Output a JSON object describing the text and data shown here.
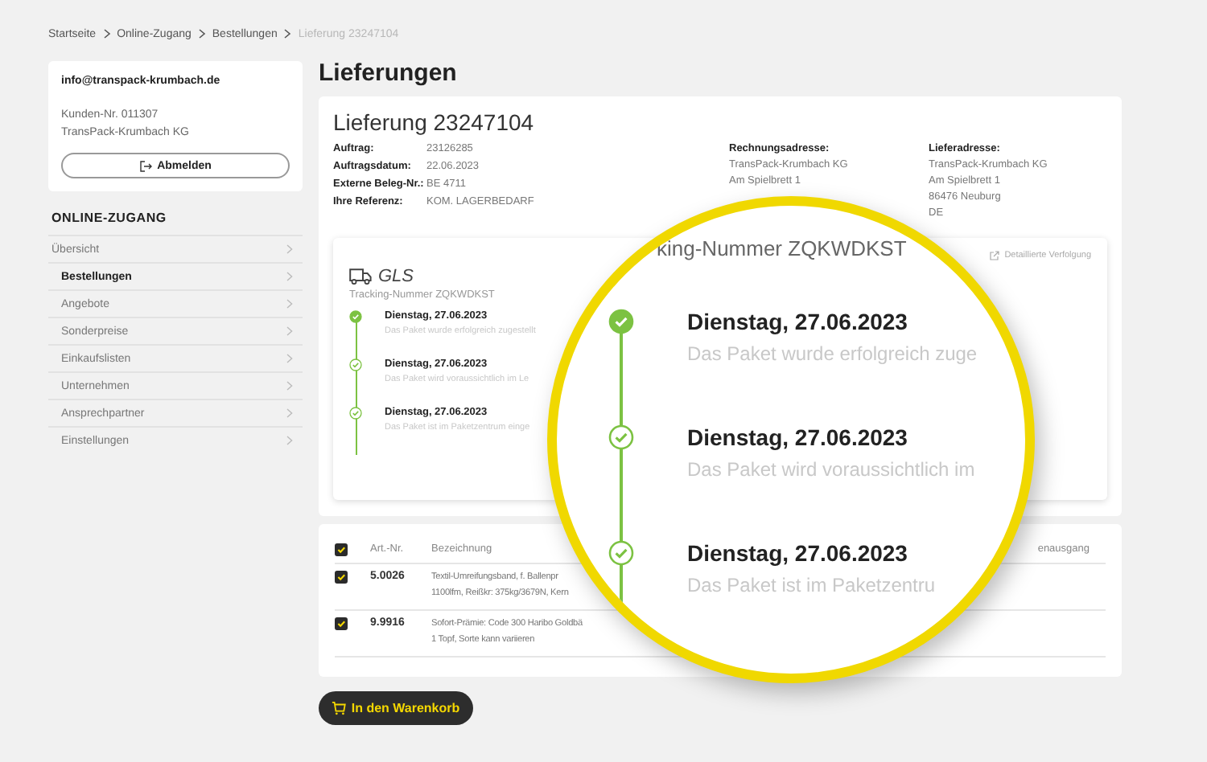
{
  "breadcrumb": [
    {
      "label": "Startseite",
      "current": false
    },
    {
      "label": "Online-Zugang",
      "current": false
    },
    {
      "label": "Bestellungen",
      "current": false
    },
    {
      "label": "Lieferung 23247104",
      "current": true
    }
  ],
  "account": {
    "email": "info@transpack-krumbach.de",
    "customer_no": "Kunden-Nr. 011307",
    "company": "TransPack-Krumbach KG",
    "logout_button": "Abmelden"
  },
  "nav": {
    "title": "ONLINE-ZUGANG",
    "items": [
      {
        "label": "Übersicht",
        "selected": false,
        "children": [
          {
            "label": "Bestellungen",
            "selected": true
          },
          {
            "label": "Angebote",
            "selected": false
          },
          {
            "label": "Sonderpreise",
            "selected": false
          },
          {
            "label": "Einkaufslisten",
            "selected": false
          },
          {
            "label": "Unternehmen",
            "selected": false
          },
          {
            "label": "Ansprechpartner",
            "selected": false
          },
          {
            "label": "Einstellungen",
            "selected": false
          }
        ]
      }
    ]
  },
  "page_title": "Lieferungen",
  "delivery": {
    "title": "Lieferung 23247104",
    "details": [
      {
        "label": "Auftrag:",
        "value": "23126285"
      },
      {
        "label": "Auftragsdatum:",
        "value": "22.06.2023"
      },
      {
        "label": "Externe Beleg-Nr.:",
        "value": "BE 4711"
      },
      {
        "label": "Ihre Referenz:",
        "value": "KOM. LAGERBEDARF"
      }
    ],
    "billing_address": {
      "title": "Rechnungsadresse:",
      "lines": [
        "TransPack-Krumbach KG",
        "Am Spielbrett 1"
      ]
    },
    "shipping_address": {
      "title": "Lieferadresse:",
      "lines": [
        "TransPack-Krumbach KG",
        "Am Spielbrett 1",
        "86476 Neuburg",
        "DE"
      ]
    }
  },
  "tracking": {
    "detail_link": "Detaillierte Verfolgung",
    "carrier": "GLS",
    "tracking_number": "Tracking-Nummer ZQKWDKST",
    "events": [
      {
        "date": "Dienstag, 27.06.2023",
        "text": "Das Paket wurde erfolgreich zugestellt",
        "done": true
      },
      {
        "date": "Dienstag, 27.06.2023",
        "text": "Das Paket wird voraussichtlich im Le",
        "done": false
      },
      {
        "date": "Dienstag, 27.06.2023",
        "text": "Das Paket ist im Paketzentrum einge",
        "done": false
      }
    ]
  },
  "items_table": {
    "header_checked": true,
    "columns": [
      "Art.-Nr.",
      "Bezeichnung",
      "enausgang"
    ],
    "rows": [
      {
        "checked": true,
        "number": "5.0026",
        "description": [
          "Textil-Umreifungsband, f. Ballenpr",
          "1100lfm, Reißkr: 375kg/3679N, Kern"
        ]
      },
      {
        "checked": true,
        "number": "9.9916",
        "description": [
          "Sofort-Prämie: Code 300 Haribo Goldbä",
          "1 Topf, Sorte kann variieren"
        ]
      }
    ]
  },
  "cart_button": "In den Warenkorb",
  "magnifier": {
    "tracking_number": "king-Nummer ZQKWDKST",
    "events": [
      {
        "date": "Dienstag, 27.06.2023",
        "text": "Das Paket wurde erfolgreich zuge",
        "done": true
      },
      {
        "date": "Dienstag, 27.06.2023",
        "text": "Das Paket wird voraussichtlich im",
        "done": false
      },
      {
        "date": "Dienstag, 27.06.2023",
        "text": "Das Paket ist im Paketzentru",
        "done": false
      }
    ]
  }
}
